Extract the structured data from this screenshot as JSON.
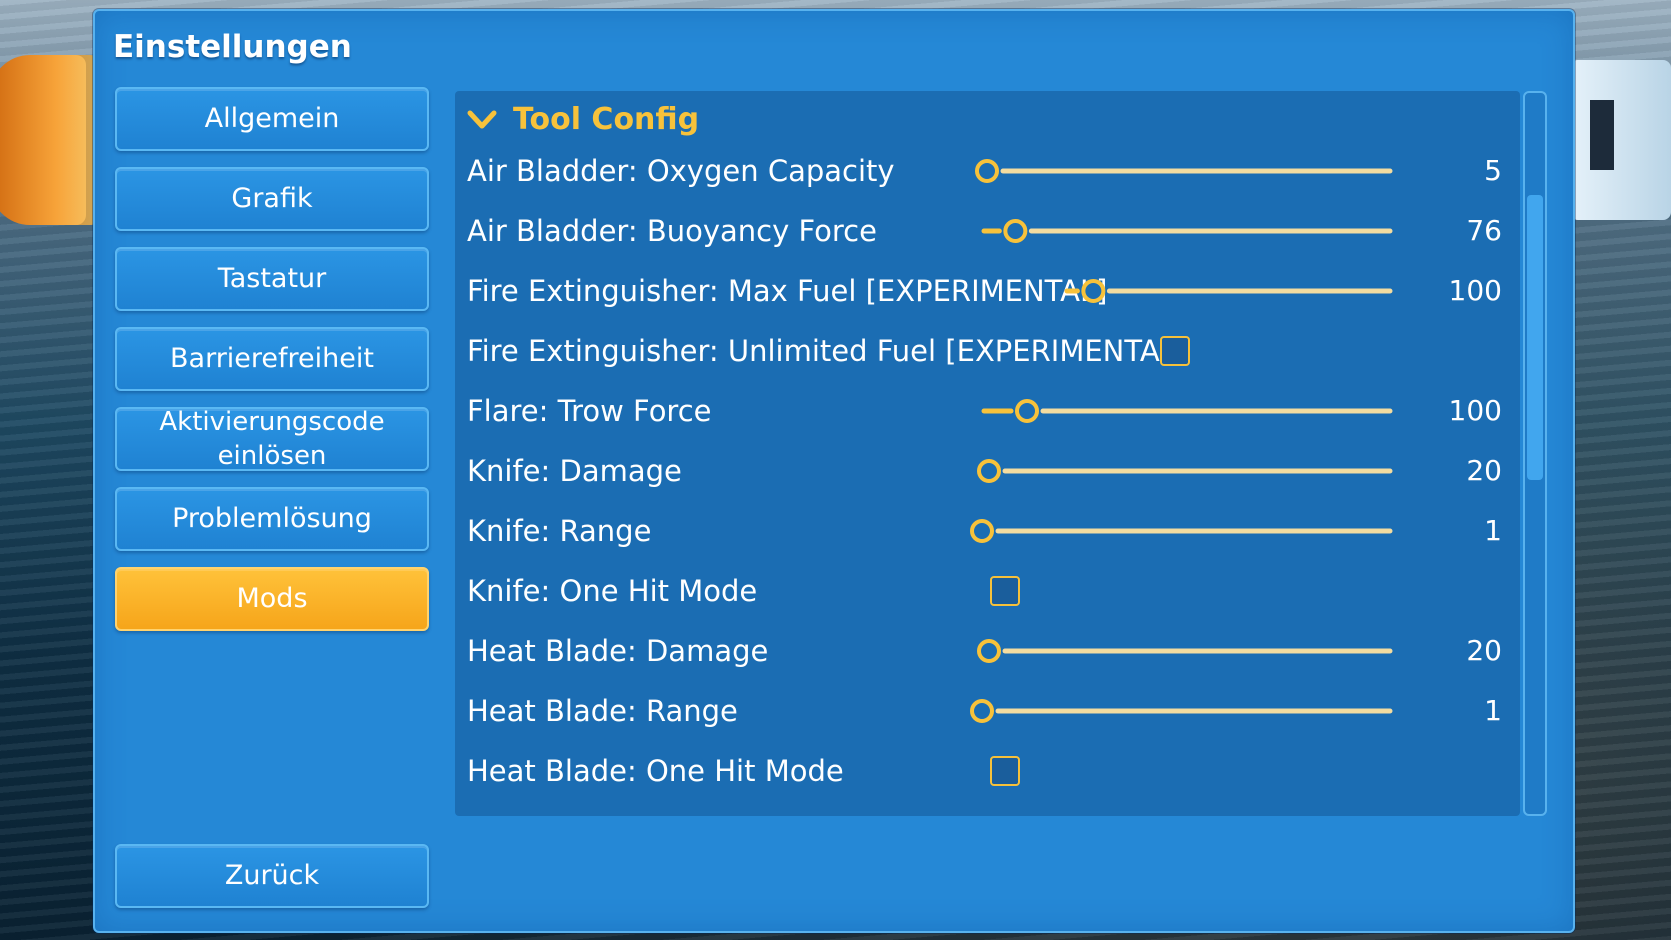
{
  "window": {
    "title": "Einstellungen"
  },
  "sidebar": {
    "items": [
      {
        "label": "Allgemein",
        "active": false
      },
      {
        "label": "Grafik",
        "active": false
      },
      {
        "label": "Tastatur",
        "active": false
      },
      {
        "label": "Barrierefreiheit",
        "active": false
      },
      {
        "label_line1": "Aktivierungscode",
        "label_line2": "einlösen",
        "active": false
      },
      {
        "label": "Problemlösung",
        "active": false
      },
      {
        "label": "Mods",
        "active": true
      }
    ],
    "back_label": "Zurück"
  },
  "section": {
    "title": "Tool Config",
    "expanded": true,
    "icon": "chevron-down-icon"
  },
  "settings": [
    {
      "label": "Air Bladder: Oxygen Capacity",
      "type": "slider",
      "value": "5",
      "fraction": 0.0
    },
    {
      "label": "Air Bladder: Buoyancy Force",
      "type": "slider",
      "value": "76",
      "fraction": 0.06
    },
    {
      "label": "Fire Extinguisher: Max Fuel [EXPERIMENTAL]",
      "type": "slider",
      "value": "100",
      "fraction": 0.06
    },
    {
      "label": "Fire Extinguisher: Unlimited Fuel [EXPERIMENTAL]",
      "type": "checkbox",
      "checked": false
    },
    {
      "label": "Flare: Trow Force",
      "type": "slider",
      "value": "100",
      "fraction": 0.09
    },
    {
      "label": "Knife: Damage",
      "type": "slider",
      "value": "20",
      "fraction": 0.0
    },
    {
      "label": "Knife: Range",
      "type": "slider",
      "value": "1",
      "fraction": 0.0
    },
    {
      "label": "Knife: One Hit Mode",
      "type": "checkbox",
      "checked": false
    },
    {
      "label": "Heat Blade: Damage",
      "type": "slider",
      "value": "20",
      "fraction": 0.0
    },
    {
      "label": "Heat Blade: Range",
      "type": "slider",
      "value": "1",
      "fraction": 0.0
    },
    {
      "label": "Heat Blade: One Hit Mode",
      "type": "checkbox",
      "checked": false
    }
  ],
  "colors": {
    "panel": "#2588d6",
    "content": "#1b6db3",
    "accent": "#f7c23b",
    "active_button": "#f6a51a"
  }
}
